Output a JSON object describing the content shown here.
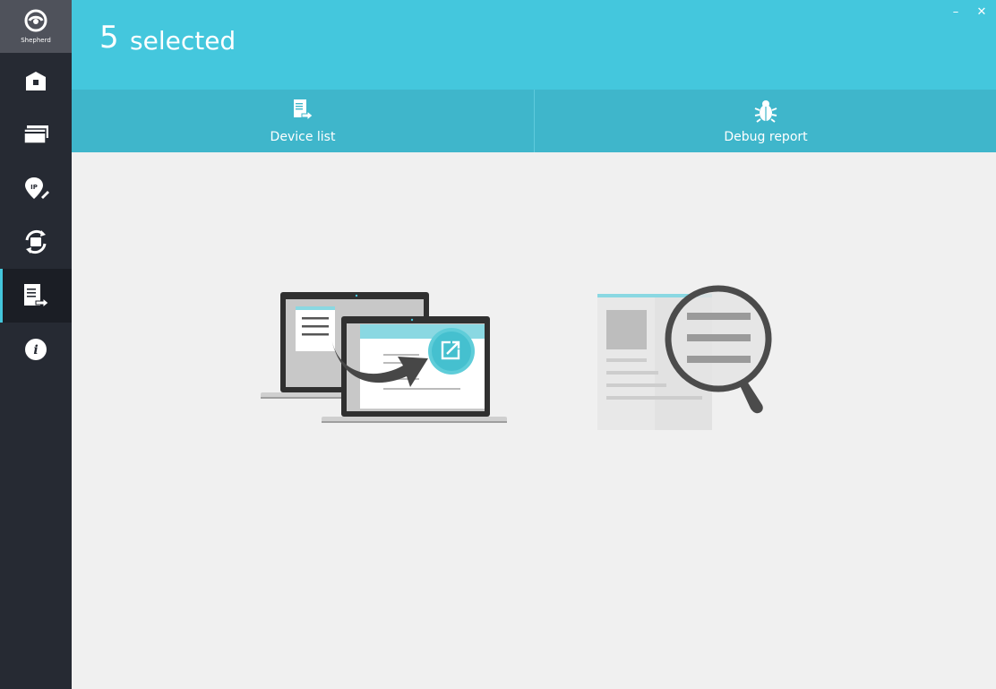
{
  "app": {
    "name": "Shepherd"
  },
  "sidebar": {
    "items": [
      {
        "icon": "home-icon"
      },
      {
        "icon": "devices-icon"
      },
      {
        "icon": "ip-location-icon"
      },
      {
        "icon": "firmware-update-icon"
      },
      {
        "icon": "export-icon",
        "active": true
      },
      {
        "icon": "info-icon"
      }
    ]
  },
  "header": {
    "count": "5",
    "count_label": "selected"
  },
  "window": {
    "minimize": "–",
    "close": "✕"
  },
  "tabs": [
    {
      "label": "Device list",
      "icon": "export-document-icon"
    },
    {
      "label": "Debug report",
      "icon": "bug-icon"
    }
  ],
  "colors": {
    "accent": "#44c7dd",
    "sidebar": "#262a33",
    "tabbar": "#3fb6cb",
    "background": "#f0f0f0"
  }
}
